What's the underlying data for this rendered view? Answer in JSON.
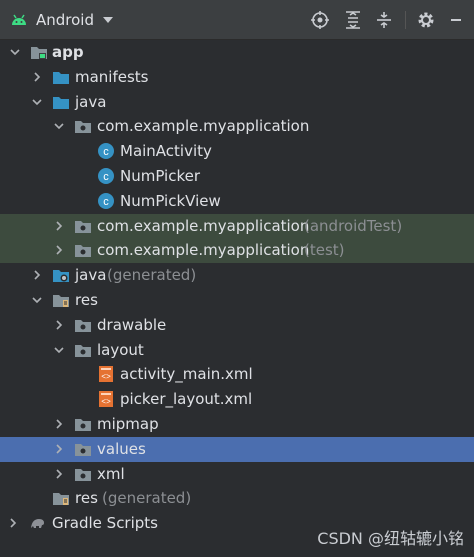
{
  "toolbar": {
    "view_label": "Android",
    "icons": [
      "target-icon",
      "expand-all-icon",
      "collapse-all-icon",
      "gear-icon",
      "minimize-icon"
    ]
  },
  "tree": {
    "app": "app",
    "manifests": "manifests",
    "java": "java",
    "package_main": "com.example.myapplication",
    "class_main_activity": "MainActivity",
    "class_num_picker": "NumPicker",
    "class_num_pick_view": "NumPickView",
    "package_android_test": "com.example.myapplication",
    "package_android_test_suffix": "(androidTest)",
    "package_test": "com.example.myapplication",
    "package_test_suffix": "(test)",
    "java_generated": "java",
    "java_generated_suffix": "(generated)",
    "res": "res",
    "drawable": "drawable",
    "layout": "layout",
    "activity_main_xml": "activity_main.xml",
    "picker_layout_xml": "picker_layout.xml",
    "mipmap": "mipmap",
    "values": "values",
    "xml": "xml",
    "res_generated": "res",
    "res_generated_suffix": "(generated)",
    "gradle_scripts": "Gradle Scripts"
  },
  "watermark": "CSDN @纽轱辘小铭",
  "colors": {
    "background": "#2b2d30",
    "test_source_highlight": "#3d4b3e",
    "selection": "#4b6eaf",
    "android_green": "#3ddc84",
    "folder": "#87939a",
    "source_folder": "#3592c4",
    "class_icon": "#3592c4"
  }
}
